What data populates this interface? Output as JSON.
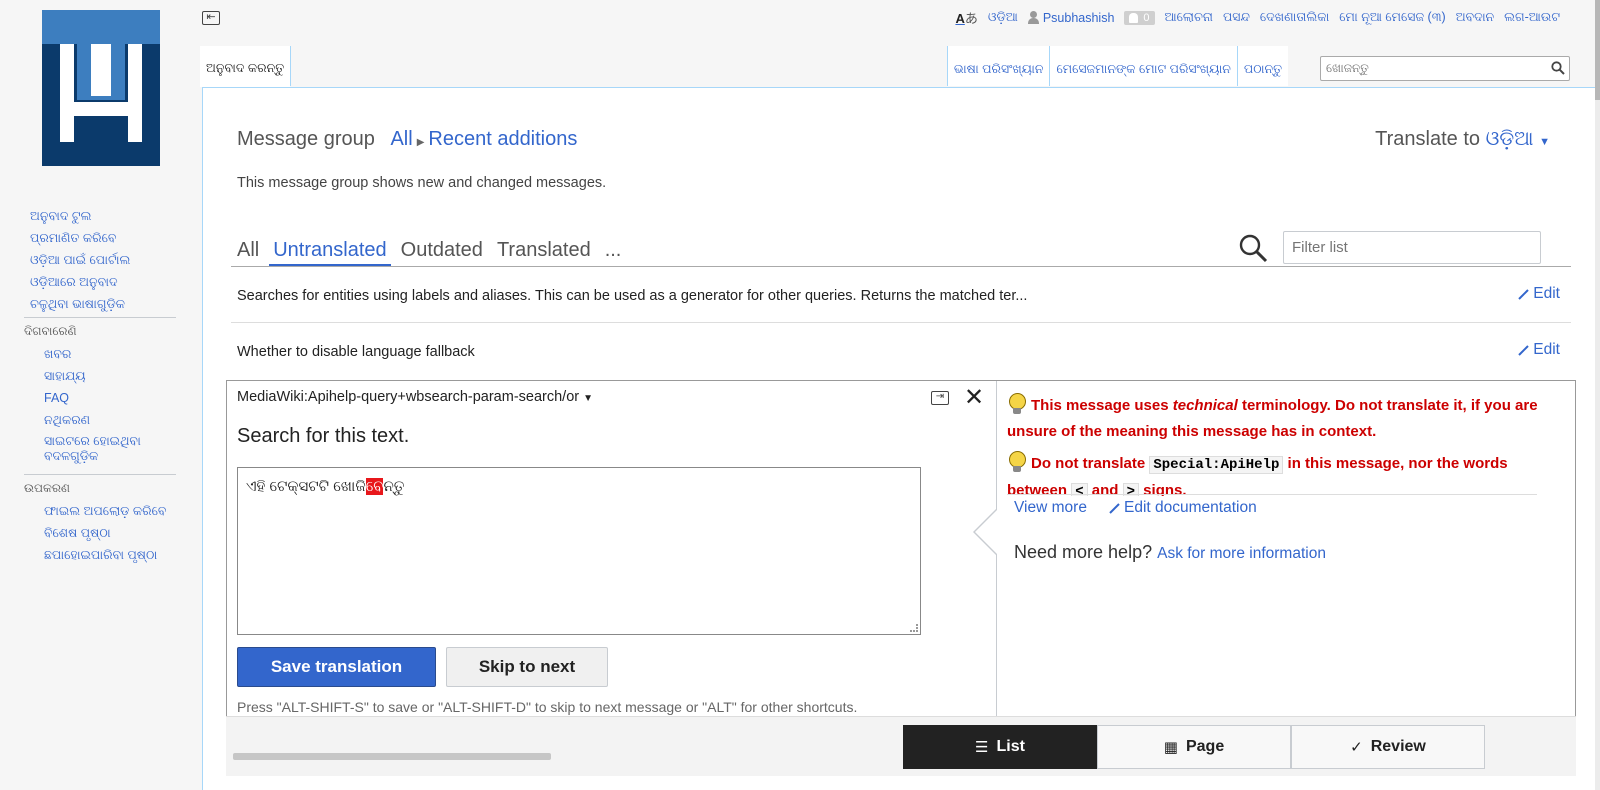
{
  "sidebar": {
    "nav": [
      "ଅନୁବାଦ ଟୁଲ",
      "ପ୍ରମାଣିତ କରିବେ",
      "ଓଡ଼ିଆ ପାଇଁ ପୋର୍ଟାଲ",
      "ଓଡ଼ିଆରେ ଅନୁବାଦ",
      "ଚଳୁଥିବା ଭାଷାଗୁଡ଼ିକ"
    ],
    "portal1": {
      "heading": "ଦିଗବାରେଣି",
      "items": [
        "ଖବର",
        "ସାହାଯ୍ୟ",
        "FAQ",
        "ନଥିକରଣ",
        "ସାଇଟରେ ହୋଇଥିବା ବଦଳଗୁଡ଼ିକ"
      ]
    },
    "portal2": {
      "heading": "ଉପକରଣ",
      "items": [
        "ଫାଇଲ ଅପଲୋଡ଼ କରିବେ",
        "ବିଶେଷ ପୃଷ୍ଠା",
        "ଛପାହୋଇପାରିବା ପୃଷ୍ଠା"
      ]
    }
  },
  "personal": {
    "lang_icon": "A",
    "lang_icon_alt": "あ",
    "language": "ଓଡ଼ିଆ",
    "username": "Psubhashish",
    "notif_count": "0",
    "links": [
      "ଆଲୋଚନା",
      "ପସନ୍ଦ",
      "ଦେଖଣାତାଲିକା",
      "ମୋ ନୂଆ ମେସେଜ (୩)",
      "ଅବଦାନ",
      "ଲଗ-ଆଉଟ"
    ]
  },
  "tabs": {
    "left": "ଅନୁବାଦ କରନ୍ତୁ",
    "right": [
      "ଭାଷା ପରିସଂଖ୍ୟାନ",
      "ମେସେଜମାନଙ୍କ ମୋଟ ପରିସଂଖ୍ୟାନ",
      "ପଠାନ୍ତୁ"
    ]
  },
  "search": {
    "placeholder": "ଖୋଜନ୍ତୁ"
  },
  "header": {
    "group_label": "Message group",
    "group_all": "All",
    "group_name": "Recent additions",
    "translate_to_label": "Translate to",
    "translate_to_lang": "ଓଡ଼ିଆ",
    "description": "This message group shows new and changed messages."
  },
  "filter": {
    "tabs": [
      "All",
      "Untranslated",
      "Outdated",
      "Translated",
      "..."
    ],
    "active_index": 1,
    "placeholder": "Filter list"
  },
  "rows": [
    {
      "text": "Searches for entities using labels and aliases. This can be used as a generator for other queries. Returns the matched ter...",
      "edit": "Edit"
    },
    {
      "text": "Whether to disable language fallback",
      "edit": "Edit"
    }
  ],
  "editor": {
    "message_key": "MediaWiki:Apihelp-query+wbsearch-param-search/or",
    "source": "Search for this text.",
    "translation_before": "ଏହି ଟେକ୍ସଟଟି ଖୋଜି",
    "translation_error": "ବେ",
    "translation_after": "ନ୍ତୁ",
    "save_label": "Save translation",
    "skip_label": "Skip to next",
    "shortcuts": "Press \"ALT-SHIFT-S\" to save or \"ALT-SHIFT-D\" to skip to next message or \"ALT\" for other shortcuts."
  },
  "hints": {
    "hint1_pre": "This message uses ",
    "hint1_em": "technical",
    "hint1_post": " terminology. Do not translate it, if you are unsure of the meaning this message has in context.",
    "hint2_pre": "Do not translate ",
    "hint2_code": "Special:ApiHelp",
    "hint2_mid": " in this message, nor the words between ",
    "hint2_code2": "<",
    "hint2_and": " and ",
    "hint2_code3": ">",
    "hint2_post": " signs.",
    "view_more": "View more",
    "edit_doc": "Edit documentation",
    "help_label": "Need more help?",
    "help_link": "Ask for more information"
  },
  "view_switcher": [
    {
      "label": "List",
      "icon": "list-icon"
    },
    {
      "label": "Page",
      "icon": "page-grid-icon"
    },
    {
      "label": "Review",
      "icon": "checkmark-icon"
    }
  ],
  "colors": {
    "link": "#3366cc",
    "primary_button": "#3366cc",
    "warning": "#cc0000",
    "logo_light": "#3d7ebf",
    "logo_dark": "#0b3a6b"
  }
}
